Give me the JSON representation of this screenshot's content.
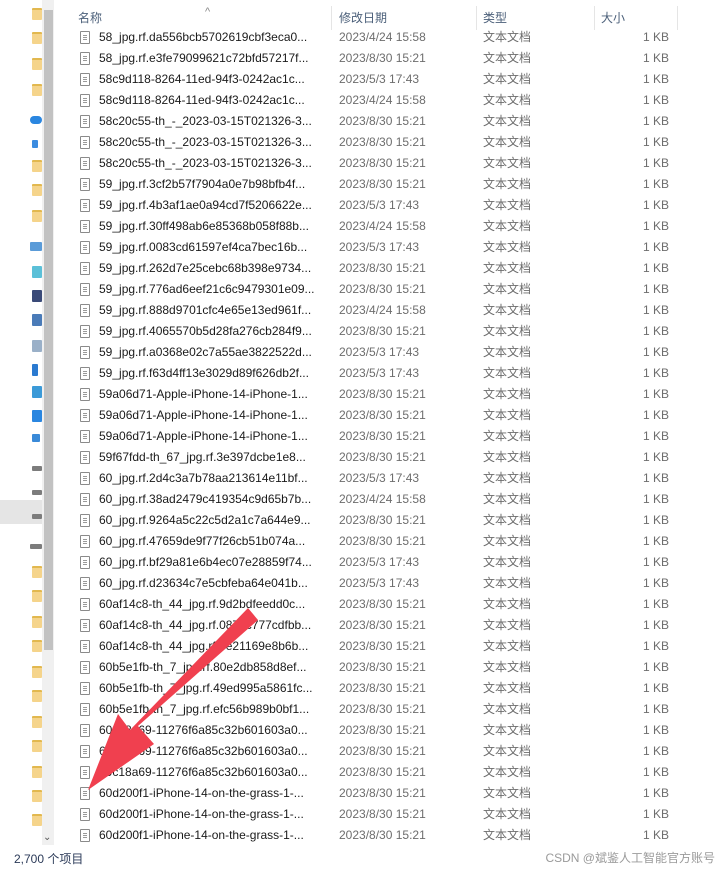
{
  "columns": {
    "name": "名称",
    "modified": "修改日期",
    "type": "类型",
    "size": "大小"
  },
  "files": [
    {
      "name": "58_jpg.rf.da556bcb5702619cbf3eca0...",
      "modified": "2023/4/24 15:58",
      "type": "文本文档",
      "size": "1 KB"
    },
    {
      "name": "58_jpg.rf.e3fe79099621c72bfd57217f...",
      "modified": "2023/8/30 15:21",
      "type": "文本文档",
      "size": "1 KB"
    },
    {
      "name": "58c9d118-8264-11ed-94f3-0242ac1c...",
      "modified": "2023/5/3 17:43",
      "type": "文本文档",
      "size": "1 KB"
    },
    {
      "name": "58c9d118-8264-11ed-94f3-0242ac1c...",
      "modified": "2023/4/24 15:58",
      "type": "文本文档",
      "size": "1 KB"
    },
    {
      "name": "58c20c55-th_-_2023-03-15T021326-3...",
      "modified": "2023/8/30 15:21",
      "type": "文本文档",
      "size": "1 KB"
    },
    {
      "name": "58c20c55-th_-_2023-03-15T021326-3...",
      "modified": "2023/8/30 15:21",
      "type": "文本文档",
      "size": "1 KB"
    },
    {
      "name": "58c20c55-th_-_2023-03-15T021326-3...",
      "modified": "2023/8/30 15:21",
      "type": "文本文档",
      "size": "1 KB"
    },
    {
      "name": "59_jpg.rf.3cf2b57f7904a0e7b98bfb4f...",
      "modified": "2023/8/30 15:21",
      "type": "文本文档",
      "size": "1 KB"
    },
    {
      "name": "59_jpg.rf.4b3af1ae0a94cd7f5206622e...",
      "modified": "2023/5/3 17:43",
      "type": "文本文档",
      "size": "1 KB"
    },
    {
      "name": "59_jpg.rf.30ff498ab6e85368b058f88b...",
      "modified": "2023/4/24 15:58",
      "type": "文本文档",
      "size": "1 KB"
    },
    {
      "name": "59_jpg.rf.0083cd61597ef4ca7bec16b...",
      "modified": "2023/5/3 17:43",
      "type": "文本文档",
      "size": "1 KB"
    },
    {
      "name": "59_jpg.rf.262d7e25cebc68b398e9734...",
      "modified": "2023/8/30 15:21",
      "type": "文本文档",
      "size": "1 KB"
    },
    {
      "name": "59_jpg.rf.776ad6eef21c6c9479301e09...",
      "modified": "2023/8/30 15:21",
      "type": "文本文档",
      "size": "1 KB"
    },
    {
      "name": "59_jpg.rf.888d9701cfc4e65e13ed961f...",
      "modified": "2023/4/24 15:58",
      "type": "文本文档",
      "size": "1 KB"
    },
    {
      "name": "59_jpg.rf.4065570b5d28fa276cb284f9...",
      "modified": "2023/8/30 15:21",
      "type": "文本文档",
      "size": "1 KB"
    },
    {
      "name": "59_jpg.rf.a0368e02c7a55ae3822522d...",
      "modified": "2023/5/3 17:43",
      "type": "文本文档",
      "size": "1 KB"
    },
    {
      "name": "59_jpg.rf.f63d4ff13e3029d89f626db2f...",
      "modified": "2023/5/3 17:43",
      "type": "文本文档",
      "size": "1 KB"
    },
    {
      "name": "59a06d71-Apple-iPhone-14-iPhone-1...",
      "modified": "2023/8/30 15:21",
      "type": "文本文档",
      "size": "1 KB"
    },
    {
      "name": "59a06d71-Apple-iPhone-14-iPhone-1...",
      "modified": "2023/8/30 15:21",
      "type": "文本文档",
      "size": "1 KB"
    },
    {
      "name": "59a06d71-Apple-iPhone-14-iPhone-1...",
      "modified": "2023/8/30 15:21",
      "type": "文本文档",
      "size": "1 KB"
    },
    {
      "name": "59f67fdd-th_67_jpg.rf.3e397dcbe1e8...",
      "modified": "2023/8/30 15:21",
      "type": "文本文档",
      "size": "1 KB"
    },
    {
      "name": "60_jpg.rf.2d4c3a7b78aa213614e11bf...",
      "modified": "2023/5/3 17:43",
      "type": "文本文档",
      "size": "1 KB"
    },
    {
      "name": "60_jpg.rf.38ad2479c419354c9d65b7b...",
      "modified": "2023/4/24 15:58",
      "type": "文本文档",
      "size": "1 KB"
    },
    {
      "name": "60_jpg.rf.9264a5c22c5d2a1c7a644e9...",
      "modified": "2023/8/30 15:21",
      "type": "文本文档",
      "size": "1 KB"
    },
    {
      "name": "60_jpg.rf.47659de9f77f26cb51b074a...",
      "modified": "2023/8/30 15:21",
      "type": "文本文档",
      "size": "1 KB"
    },
    {
      "name": "60_jpg.rf.bf29a81e6b4ec07e28859f74...",
      "modified": "2023/5/3 17:43",
      "type": "文本文档",
      "size": "1 KB"
    },
    {
      "name": "60_jpg.rf.d23634c7e5cbfeba64e041b...",
      "modified": "2023/5/3 17:43",
      "type": "文本文档",
      "size": "1 KB"
    },
    {
      "name": "60af14c8-th_44_jpg.rf.9d2bdfeedd0c...",
      "modified": "2023/8/30 15:21",
      "type": "文本文档",
      "size": "1 KB"
    },
    {
      "name": "60af14c8-th_44_jpg.rf.0873c777cdfbb...",
      "modified": "2023/8/30 15:21",
      "type": "文本文档",
      "size": "1 KB"
    },
    {
      "name": "60af14c8-th_44_jpg.rf.9e21169e8b6b...",
      "modified": "2023/8/30 15:21",
      "type": "文本文档",
      "size": "1 KB"
    },
    {
      "name": "60b5e1fb-th_7_jpg.rf.80e2db858d8ef...",
      "modified": "2023/8/30 15:21",
      "type": "文本文档",
      "size": "1 KB"
    },
    {
      "name": "60b5e1fb-th_7_jpg.rf.49ed995a5861fc...",
      "modified": "2023/8/30 15:21",
      "type": "文本文档",
      "size": "1 KB"
    },
    {
      "name": "60b5e1fb-th_7_jpg.rf.efc56b989b0bf1...",
      "modified": "2023/8/30 15:21",
      "type": "文本文档",
      "size": "1 KB"
    },
    {
      "name": "60c18a69-11276f6a85c32b601603a0...",
      "modified": "2023/8/30 15:21",
      "type": "文本文档",
      "size": "1 KB"
    },
    {
      "name": "60c18a69-11276f6a85c32b601603a0...",
      "modified": "2023/8/30 15:21",
      "type": "文本文档",
      "size": "1 KB"
    },
    {
      "name": "60c18a69-11276f6a85c32b601603a0...",
      "modified": "2023/8/30 15:21",
      "type": "文本文档",
      "size": "1 KB"
    },
    {
      "name": "60d200f1-iPhone-14-on-the-grass-1-...",
      "modified": "2023/8/30 15:21",
      "type": "文本文档",
      "size": "1 KB"
    },
    {
      "name": "60d200f1-iPhone-14-on-the-grass-1-...",
      "modified": "2023/8/30 15:21",
      "type": "文本文档",
      "size": "1 KB"
    },
    {
      "name": "60d200f1-iPhone-14-on-the-grass-1-...",
      "modified": "2023/8/30 15:21",
      "type": "文本文档",
      "size": "1 KB"
    }
  ],
  "status": {
    "item_count": "2,700 个项目"
  },
  "watermark": "CSDN @斌鉴人工智能官方账号",
  "colors": {
    "annotation_arrow": "#f0404f",
    "header_text": "#4c607a"
  },
  "icons": {
    "file": "text-file-icon",
    "sort": "sort-up-icon"
  }
}
